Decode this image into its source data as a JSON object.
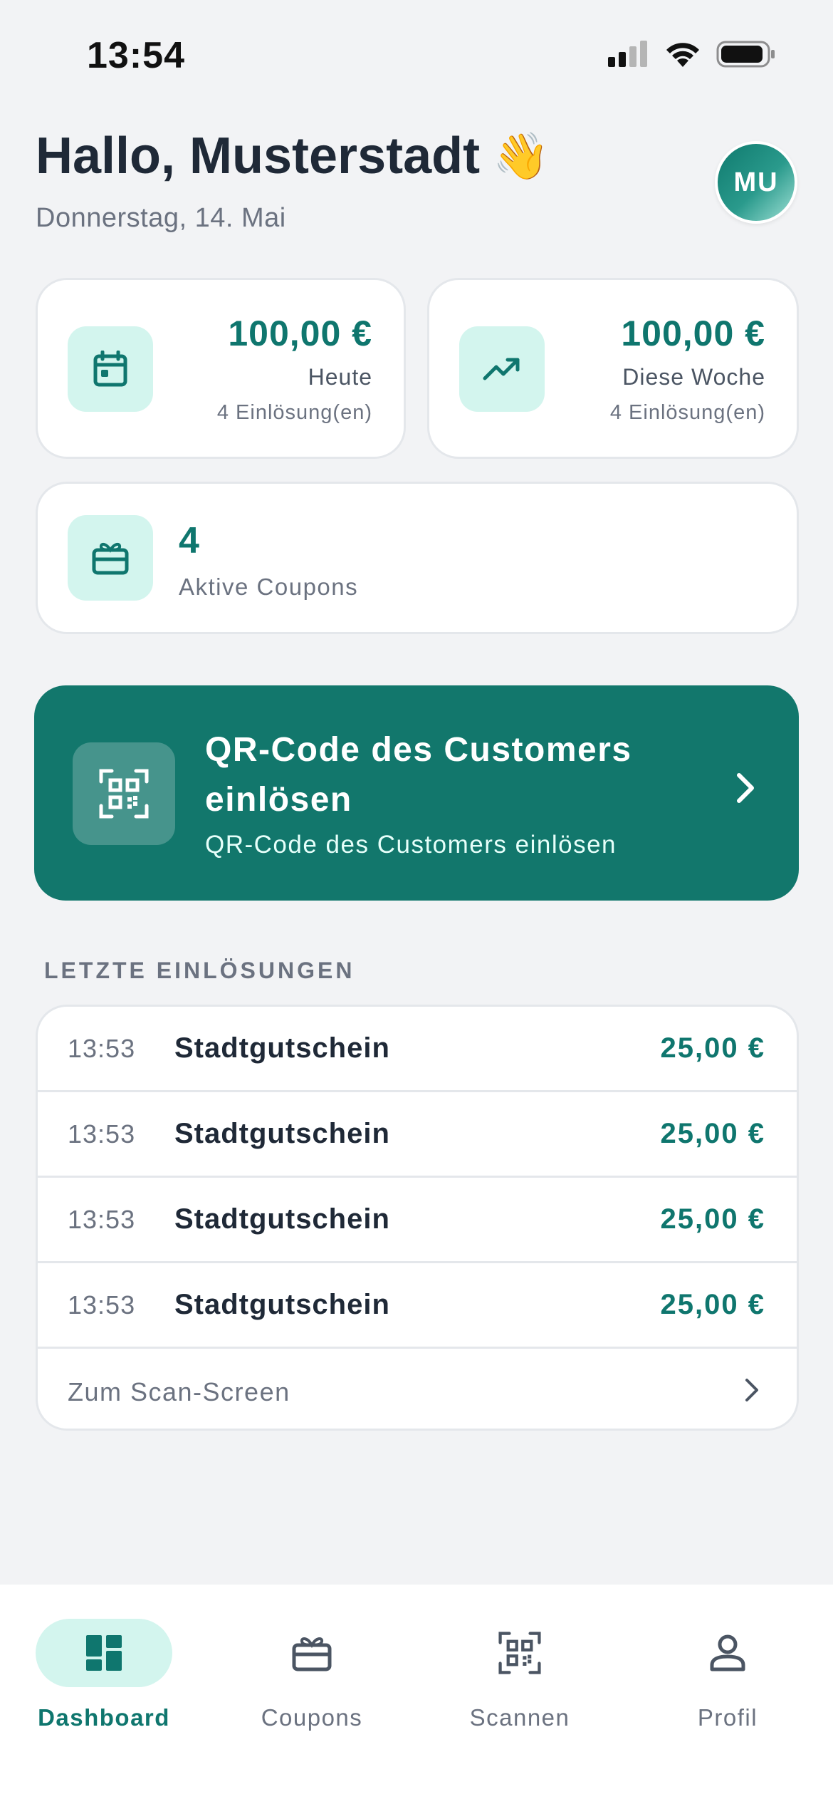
{
  "status_bar": {
    "time": "13:54"
  },
  "header": {
    "greeting": "Hallo, Musterstadt",
    "wave_emoji": "👋",
    "date": "Donnerstag, 14. Mai",
    "avatar_initials": "MU"
  },
  "stats": {
    "today": {
      "icon": "calendar-icon",
      "value": "100,00 €",
      "label": "Heute",
      "sub": "4 Einlösung(en)"
    },
    "week": {
      "icon": "trending-up-icon",
      "value": "100,00 €",
      "label": "Diese Woche",
      "sub": "4 Einlösung(en)"
    },
    "coupons": {
      "icon": "gift-icon",
      "value": "4",
      "label": "Aktive Coupons"
    }
  },
  "qr_banner": {
    "title": "QR-Code des Customers einlösen",
    "subtitle": "QR-Code des Customers einlösen"
  },
  "recent": {
    "section_title": "LETZTE EINLÖSUNGEN",
    "rows": [
      {
        "time": "13:53",
        "name": "Stadtgutschein",
        "amount": "25,00 €"
      },
      {
        "time": "13:53",
        "name": "Stadtgutschein",
        "amount": "25,00 €"
      },
      {
        "time": "13:53",
        "name": "Stadtgutschein",
        "amount": "25,00 €"
      },
      {
        "time": "13:53",
        "name": "Stadtgutschein",
        "amount": "25,00 €"
      }
    ],
    "footer_link": "Zum Scan-Screen"
  },
  "tabs": [
    {
      "label": "Dashboard",
      "icon": "dashboard-icon",
      "active": true
    },
    {
      "label": "Coupons",
      "icon": "gift-icon",
      "active": false
    },
    {
      "label": "Scannen",
      "icon": "qr-scan-icon",
      "active": false
    },
    {
      "label": "Profil",
      "icon": "person-icon",
      "active": false
    }
  ],
  "colors": {
    "accent": "#0f766e",
    "banner": "#12776c",
    "icon_bg": "#d3f5ee",
    "background": "#f2f3f5"
  }
}
